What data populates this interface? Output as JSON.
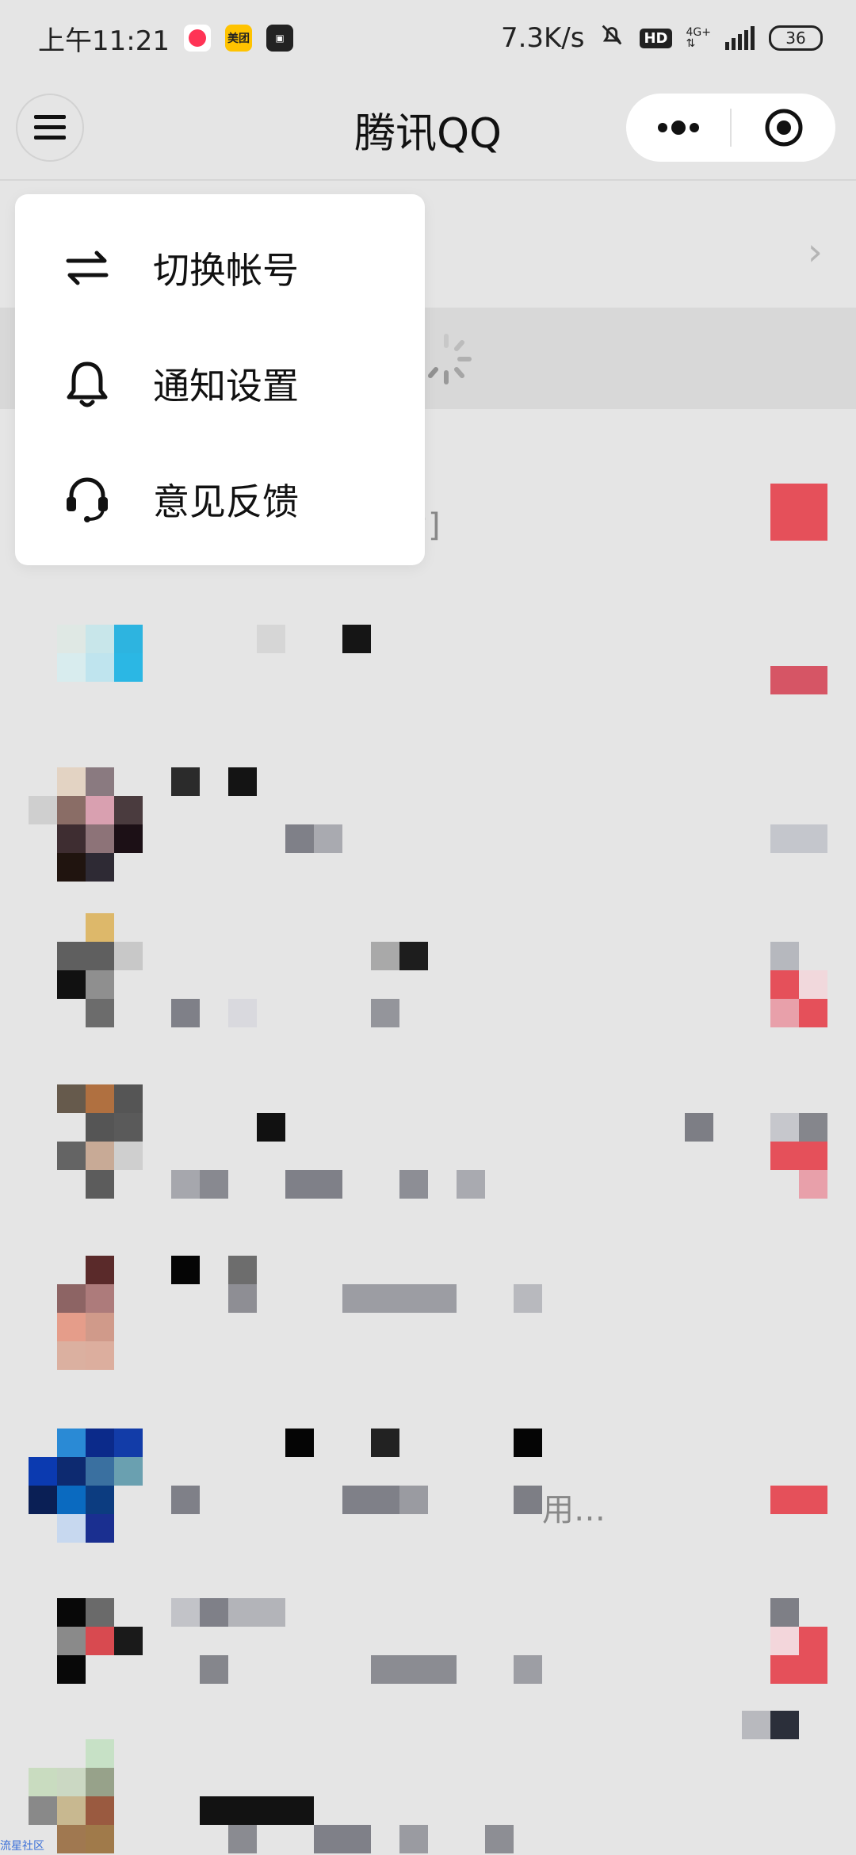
{
  "status_bar": {
    "time": "上午11:21",
    "badges": [
      "app-red-icon",
      "meituan-icon",
      "cast-icon"
    ],
    "meituan_label": "美团",
    "net_speed": "7.3K/s",
    "hd_label": "HD",
    "network_type": "4G+",
    "battery": "36"
  },
  "navbar": {
    "title": "腾讯QQ",
    "left_icon": "hamburger-menu-icon",
    "capsule_icons": [
      "more-dots-icon",
      "close-target-icon"
    ]
  },
  "dropdown_menu": {
    "items": [
      {
        "label": "切换帐号",
        "icon": "switch-arrows-icon"
      },
      {
        "label": "通知设置",
        "icon": "bell-icon"
      },
      {
        "label": "意见反馈",
        "icon": "headset-icon"
      }
    ]
  },
  "background_fragments": {
    "partial_text_1": "片]",
    "partial_text_2": "用…",
    "corner_label": "流星社区"
  },
  "colors": {
    "background": "#e5e5e5",
    "menu_background": "#ffffff",
    "text_primary": "#111111",
    "unread_red": "#e5505a"
  }
}
